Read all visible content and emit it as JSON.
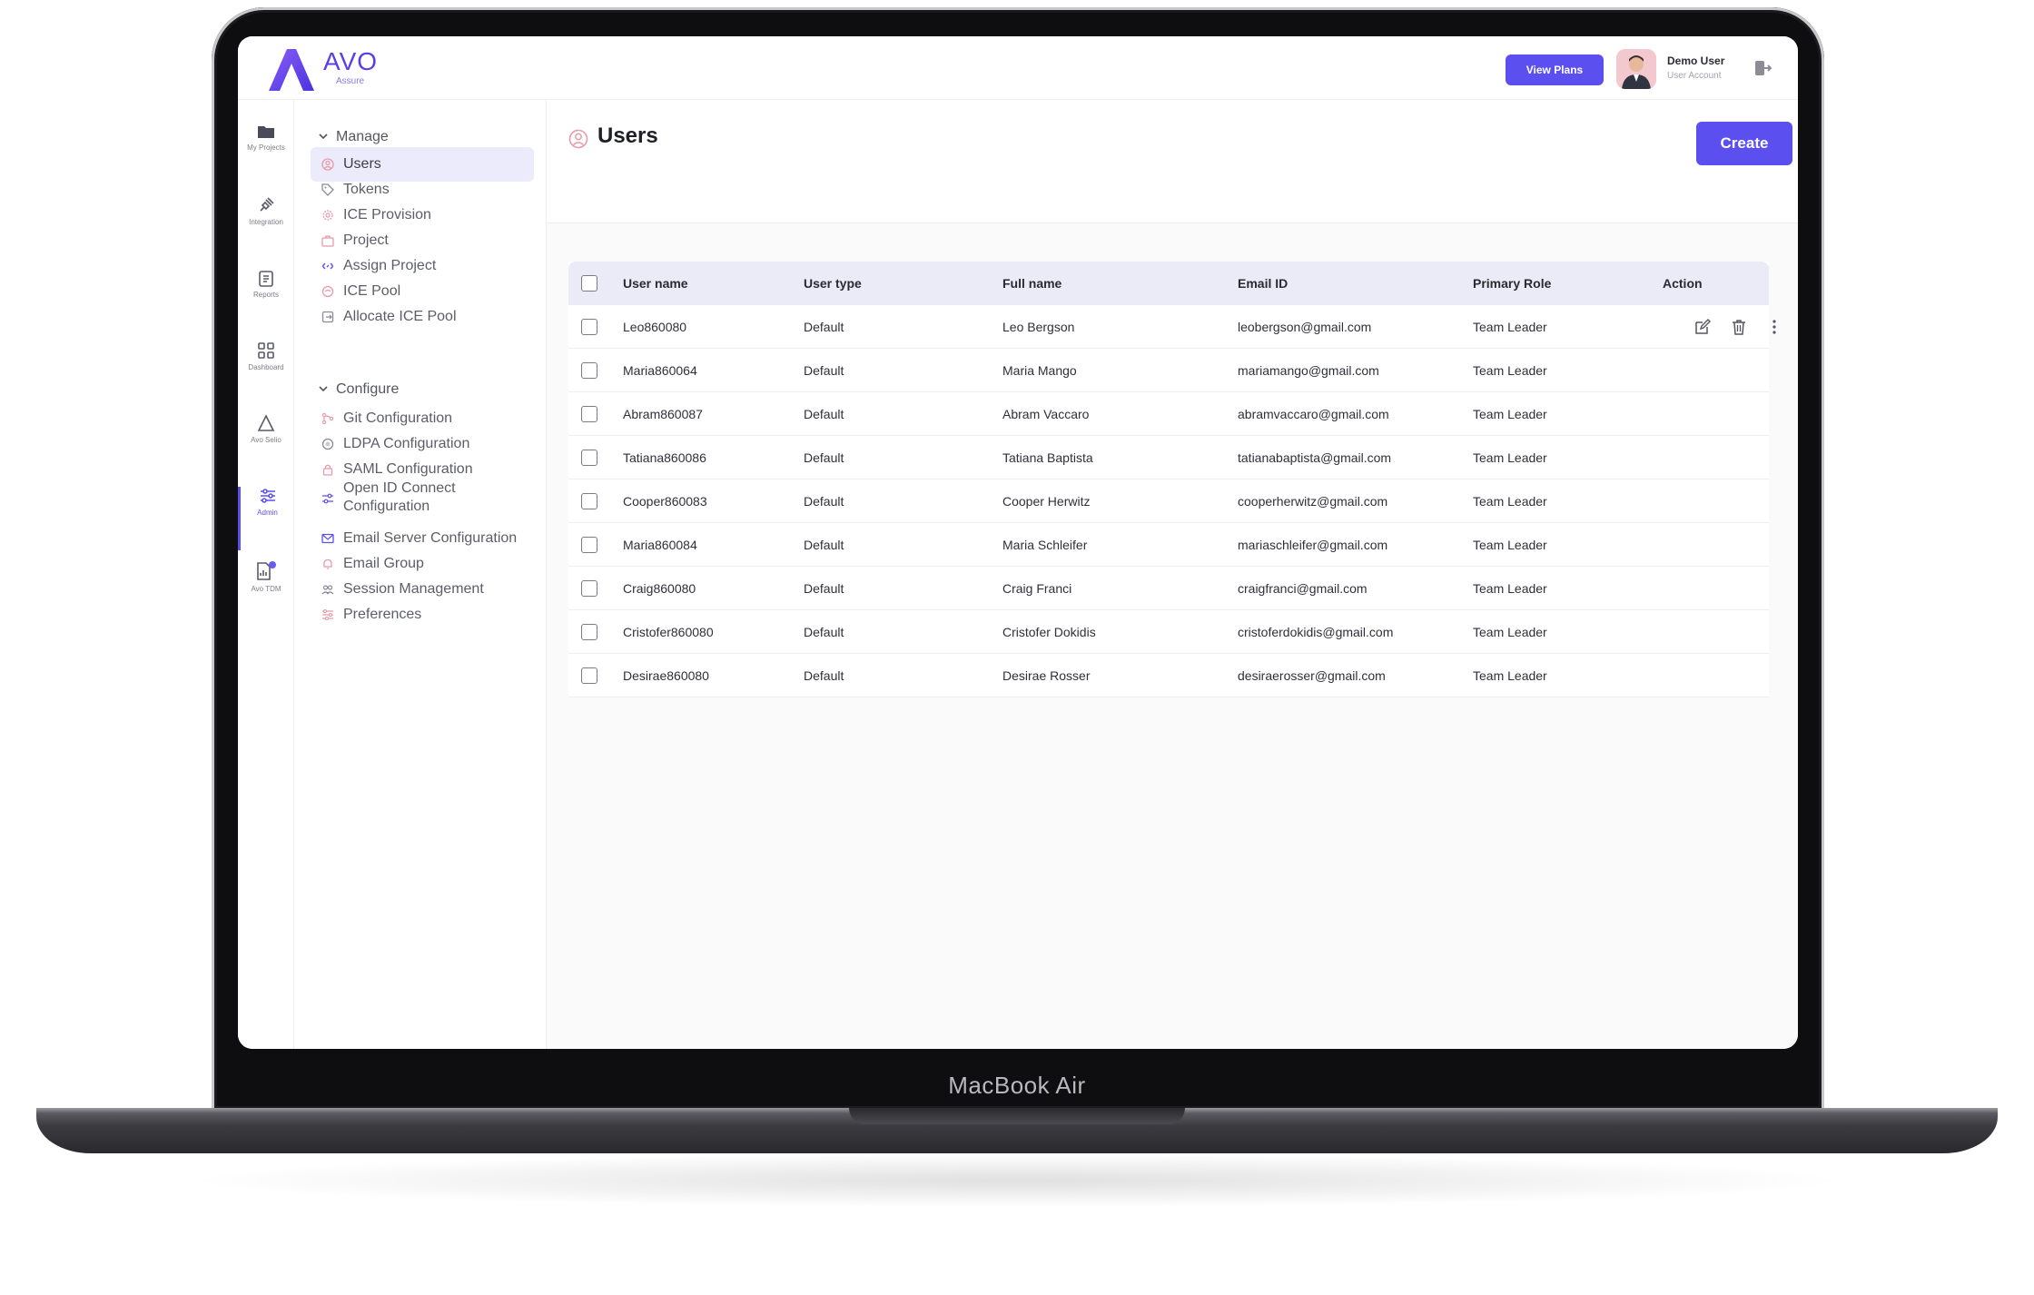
{
  "device": {
    "label": "MacBook Air"
  },
  "brand": {
    "name": "AVO",
    "sub": "Assure",
    "accent": "#5b4ff0"
  },
  "header": {
    "view_plans": "View Plans",
    "user_name": "Demo User",
    "user_role": "User Account"
  },
  "rail": {
    "items": [
      {
        "label": "My Projects",
        "icon": "folder-icon"
      },
      {
        "label": "Integration",
        "icon": "plug-icon"
      },
      {
        "label": "Reports",
        "icon": "clipboard-icon"
      },
      {
        "label": "Dashboard",
        "icon": "grid-icon"
      },
      {
        "label": "Avo Selio",
        "icon": "triangle-icon"
      },
      {
        "label": "Admin",
        "icon": "sliders-icon"
      },
      {
        "label": "Avo TDM",
        "icon": "document-chart-icon"
      }
    ]
  },
  "sidebar": {
    "manage": {
      "title": "Manage",
      "items": [
        "Users",
        "Tokens",
        "ICE Provision",
        "Project",
        "Assign Project",
        "ICE Pool",
        "Allocate ICE Pool"
      ]
    },
    "configure": {
      "title": "Configure",
      "items": [
        "Git Configuration",
        "LDPA Configuration",
        "SAML Configuration",
        "Open ID Connect Configuration",
        "Email Server Configuration",
        "Email Group",
        "Session Management",
        "Preferences"
      ]
    }
  },
  "page": {
    "title": "Users",
    "create": "Create"
  },
  "table": {
    "columns": [
      "User name",
      "User type",
      "Full name",
      "Email ID",
      "Primary Role",
      "Action"
    ],
    "rows": [
      [
        "Leo860080",
        "Default",
        "Leo Bergson",
        "leobergson@gmail.com",
        "Team Leader"
      ],
      [
        "Maria860064",
        "Default",
        "Maria Mango",
        "mariamango@gmail.com",
        "Team Leader"
      ],
      [
        "Abram860087",
        "Default",
        "Abram Vaccaro",
        "abramvaccaro@gmail.com",
        "Team Leader"
      ],
      [
        "Tatiana860086",
        "Default",
        "Tatiana Baptista",
        "tatianabaptista@gmail.com",
        "Team Leader"
      ],
      [
        "Cooper860083",
        "Default",
        "Cooper Herwitz",
        "cooperherwitz@gmail.com",
        "Team Leader"
      ],
      [
        "Maria860084",
        "Default",
        "Maria Schleifer",
        "mariaschleifer@gmail.com",
        "Team Leader"
      ],
      [
        "Craig860080",
        "Default",
        "Craig Franci",
        "craigfranci@gmail.com",
        "Team Leader"
      ],
      [
        "Cristofer860080",
        "Default",
        "Cristofer Dokidis",
        "cristoferdokidis@gmail.com",
        "Team Leader"
      ],
      [
        "Desirae860080",
        "Default",
        "Desirae Rosser",
        "desiraerosser@gmail.com",
        "Team Leader"
      ]
    ]
  }
}
